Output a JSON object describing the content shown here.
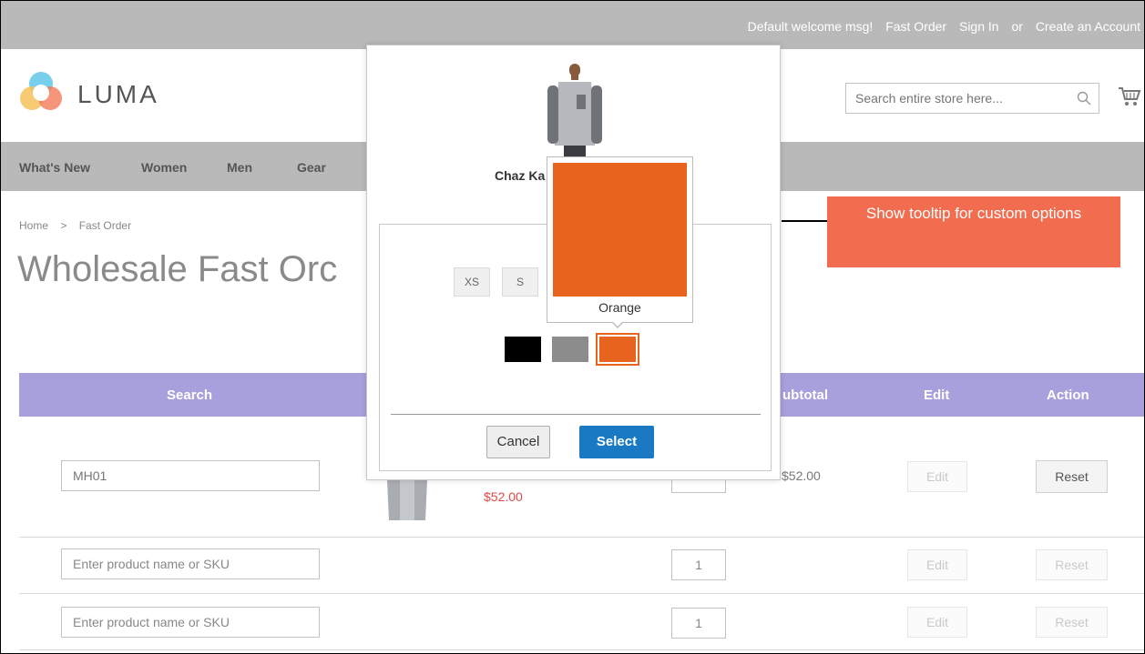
{
  "topbar": {
    "welcome": "Default welcome msg!",
    "fast_order": "Fast Order",
    "sign_in": "Sign In",
    "or": "or",
    "create_account": "Create an Account"
  },
  "header": {
    "logo_text": "LUMA",
    "search_placeholder": "Search entire store here..."
  },
  "nav": {
    "items": [
      "What's New",
      "Women",
      "Men",
      "Gear"
    ]
  },
  "breadcrumb": {
    "home": "Home",
    "separator": ">",
    "current": "Fast Order"
  },
  "page_title": "Wholesale Fast Orc",
  "table": {
    "headers": {
      "search": "Search",
      "subtotal": "ubtotal",
      "edit": "Edit",
      "action": "Action"
    },
    "rows": [
      {
        "sku": "MH01",
        "price": "$52.00",
        "subtotal": "$52.00",
        "edit": "Edit",
        "action": "Reset"
      },
      {
        "sku_placeholder": "Enter product name or SKU",
        "qty": "1",
        "edit": "Edit",
        "action": "Reset"
      },
      {
        "sku_placeholder": "Enter product name or SKU",
        "qty": "1",
        "edit": "Edit",
        "action": "Reset"
      }
    ]
  },
  "modal": {
    "product_name": "Chaz Ka",
    "sizes": [
      "XS",
      "S"
    ],
    "colors": [
      {
        "name": "Black",
        "hex": "#000000"
      },
      {
        "name": "Gray",
        "hex": "#8c8c8c"
      },
      {
        "name": "Orange",
        "hex": "#e8641e",
        "selected": true
      }
    ],
    "cancel_label": "Cancel",
    "select_label": "Select"
  },
  "tooltip": {
    "label": "Orange",
    "color": "#e8641e"
  },
  "callout": {
    "text": "Show tooltip for custom options",
    "color": "#f26d4f"
  }
}
